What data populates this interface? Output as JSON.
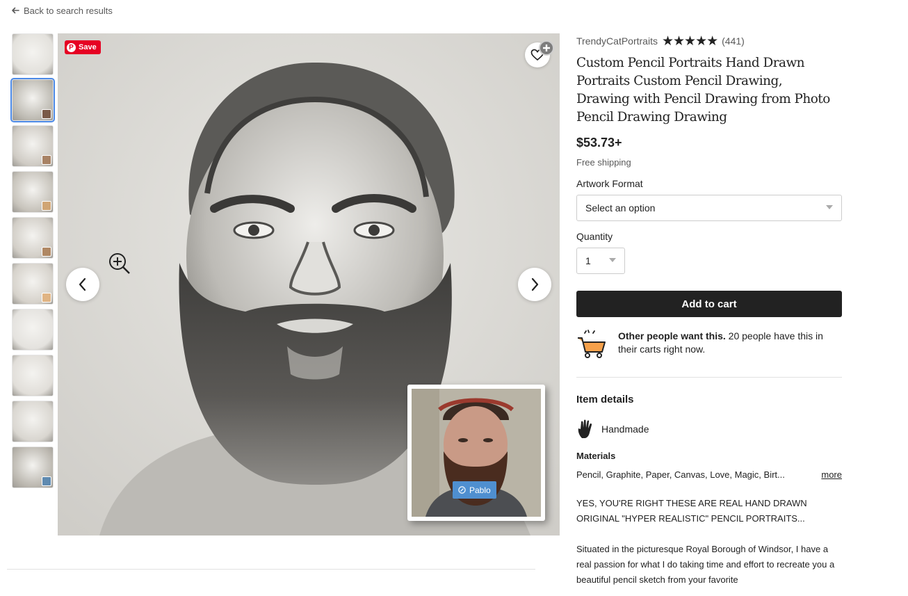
{
  "nav": {
    "back_label": "Back to search results"
  },
  "gallery": {
    "pin_save_label": "Save",
    "pablo_label": "Pablo",
    "thumbnails": [
      {
        "tint": "#e3e1dc"
      },
      {
        "tint": "#bdbab2",
        "mini": "#7a5a48"
      },
      {
        "tint": "#cfcbc4",
        "mini": "#a88264"
      },
      {
        "tint": "#c7c3bb",
        "mini": "#d0a574"
      },
      {
        "tint": "#d2cec7",
        "mini": "#b08864"
      },
      {
        "tint": "#d6d2cb",
        "mini": "#e0b484"
      },
      {
        "tint": "#e4e2de"
      },
      {
        "tint": "#e1ded9"
      },
      {
        "tint": "#d9d6d0"
      },
      {
        "tint": "#bbb7af",
        "mini": "#5f8ab0"
      }
    ]
  },
  "listing": {
    "shop_name": "TrendyCatPortraits",
    "stars": "★★★★★",
    "review_count": "(441)",
    "title": "Custom Pencil Portraits Hand Drawn Portraits Custom Pencil Drawing, Drawing with Pencil Drawing from Photo Pencil Drawing Drawing",
    "price": "$53.73+",
    "shipping": "Free shipping",
    "artwork_format_label": "Artwork Format",
    "artwork_format_value": "Select an option",
    "quantity_label": "Quantity",
    "quantity_value": "1",
    "add_to_cart_label": "Add to cart",
    "demand_bold": "Other people want this.",
    "demand_rest": " 20 people have this in their carts right now.",
    "item_details_title": "Item details",
    "handmade_label": "Handmade",
    "materials_title": "Materials",
    "materials_value": "Pencil, Graphite, Paper, Canvas, Love, Magic, Birt...",
    "materials_more": "more",
    "description_1": "YES, YOU'RE RIGHT THESE ARE REAL HAND DRAWN ORIGINAL \"HYPER REALISTIC\" PENCIL PORTRAITS...",
    "description_2": "Situated in the picturesque Royal Borough of Windsor, I have a real passion for what I do taking time and effort to recreate you a beautiful pencil sketch from your favorite"
  },
  "colors": {
    "accent_dark": "#222222",
    "pinterest_red": "#e60023",
    "pablo_blue": "#4f8fd0",
    "cart_orange": "#f5a04a",
    "selected_thumb_border": "#4d8ae6"
  }
}
